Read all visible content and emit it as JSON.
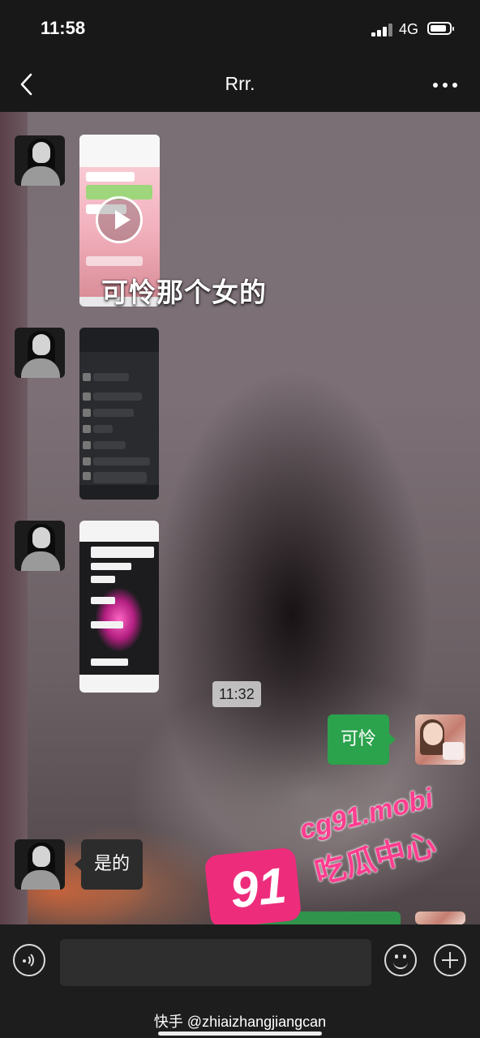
{
  "status_bar": {
    "time": "11:58",
    "network": "4G"
  },
  "header": {
    "title": "Rrr."
  },
  "messages": {
    "overlay_caption": "可怜那个女的",
    "sent_text": "可怜",
    "timestamp": "11:32",
    "received_text": "是的"
  },
  "watermark": {
    "number": "91",
    "domain": "cg91.mobi",
    "chinese": "吃瓜中心",
    "bottom_credit": "快手 @zhiaizhangjiangcan"
  },
  "icons": [
    "back-icon",
    "more-icon",
    "play-icon",
    "voice-icon",
    "emoji-icon",
    "plus-icon"
  ],
  "colors": {
    "sent_bubble": "#2ba24c",
    "received_bubble": "#2c2c2c",
    "bar_bg": "#181818",
    "watermark_pink": "#ee2c7c"
  }
}
